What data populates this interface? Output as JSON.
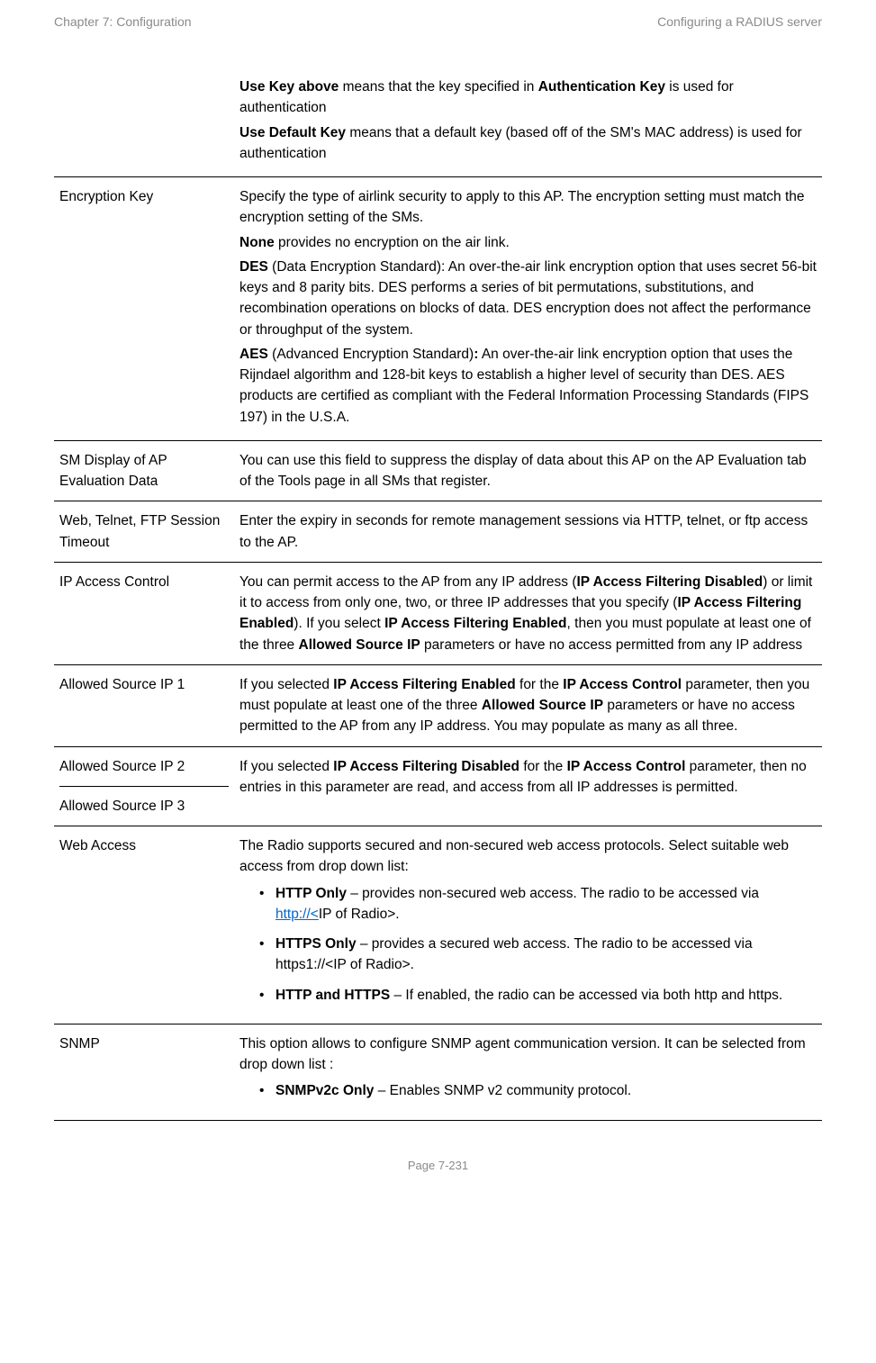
{
  "header": {
    "left": "Chapter 7:  Configuration",
    "right": "Configuring a RADIUS server"
  },
  "rows": {
    "keyNote": {
      "useKeyAbove_b": "Use Key above",
      "useKeyAbove_rest": " means that the key specified in ",
      "authKey_b": "Authentication Key",
      "useKeyAbove_tail": " is used for authentication",
      "useDefaultKey_b": "Use Default Key",
      "useDefaultKey_rest": " means that a default key (based off of the SM's MAC address) is used for authentication"
    },
    "encryptionKey": {
      "attr": "Encryption Key",
      "p1": "Specify the type of airlink security to apply to this AP. The encryption setting must match the encryption setting of the SMs.",
      "none_b": "None",
      "none_rest": " provides no encryption on the air link.",
      "des_b": "DES",
      "des_rest": " (Data Encryption Standard): An over-the-air link encryption option that uses secret 56-bit keys and 8 parity bits. DES performs a series of bit permutations, substitutions, and recombination operations on blocks of data. DES encryption does not affect the performance or throughput of the system.",
      "aes_b": "AES",
      "aes_mid": " (Advanced Encryption Standard)",
      "aes_colon_b": ":",
      "aes_rest": " An over-the-air link encryption option that uses the Rijndael algorithm and 128-bit keys to establish a higher level of security than DES. AES products are certified as compliant with the Federal Information Processing Standards (FIPS 197) in the U.S.A."
    },
    "smDisplay": {
      "attr": "SM Display of AP Evaluation Data",
      "desc": "You can use this field to suppress the display of data about this AP on the AP Evaluation tab of the Tools page in all SMs that register."
    },
    "sessionTimeout": {
      "attr": "Web, Telnet, FTP Session Timeout",
      "desc": "Enter the expiry in seconds for remote management sessions via HTTP, telnet, or ftp access to the AP."
    },
    "ipAccessControl": {
      "attr": "IP Access Control",
      "t1": "You can permit access to the AP from any IP address (",
      "b1": "IP Access Filtering Disabled",
      "t2": ") or limit it to access from only one, two, or three IP addresses that you specify (",
      "b2": "IP Access Filtering Enabled",
      "t3": "). If you select ",
      "b3": "IP Access Filtering Enabled",
      "t4": ", then you must populate at least one of the three ",
      "b4": "Allowed Source IP",
      "t5": " parameters or have no access permitted from any IP address"
    },
    "allowed1": {
      "attr": "Allowed Source IP 1",
      "t1": "If you selected ",
      "b1": "IP Access Filtering Enabled",
      "t2": " for the ",
      "b2": "IP Access Control",
      "t3": " parameter, then you must populate at least one of the three ",
      "b3": "Allowed Source IP",
      "t4": " parameters or have no access permitted to the AP from any IP address. You may populate as many as all three."
    },
    "allowed23": {
      "attr2": "Allowed Source IP 2",
      "attr3": "Allowed Source IP 3",
      "t1": "If you selected ",
      "b1": "IP Access Filtering Disabled",
      "t2": " for the ",
      "b2": "IP Access Control",
      "t3": " parameter, then no entries in this parameter are read, and access from all IP addresses is permitted."
    },
    "webAccess": {
      "attr": "Web Access",
      "intro": "The Radio supports secured and non-secured web access protocols. Select suitable web access from drop down list:",
      "li1_b": "HTTP Only",
      "li1_t1": " – provides non-secured web access. The radio to be accessed via ",
      "li1_link": "http://<",
      "li1_tail": "IP of Radio>.",
      "li2_b": "HTTPS Only",
      "li2_rest": " – provides a secured web access. The radio to be accessed via https1://<IP of Radio>.",
      "li3_b": "HTTP and HTTPS",
      "li3_rest": " – If enabled, the radio can be accessed via both http and https."
    },
    "snmp": {
      "attr": "SNMP",
      "intro": "This option allows to configure SNMP agent communication version. It can be selected from drop down list :",
      "li1_b": "SNMPv2c Only",
      "li1_rest": " – Enables SNMP v2 community protocol."
    }
  },
  "footer": "Page 7-231"
}
